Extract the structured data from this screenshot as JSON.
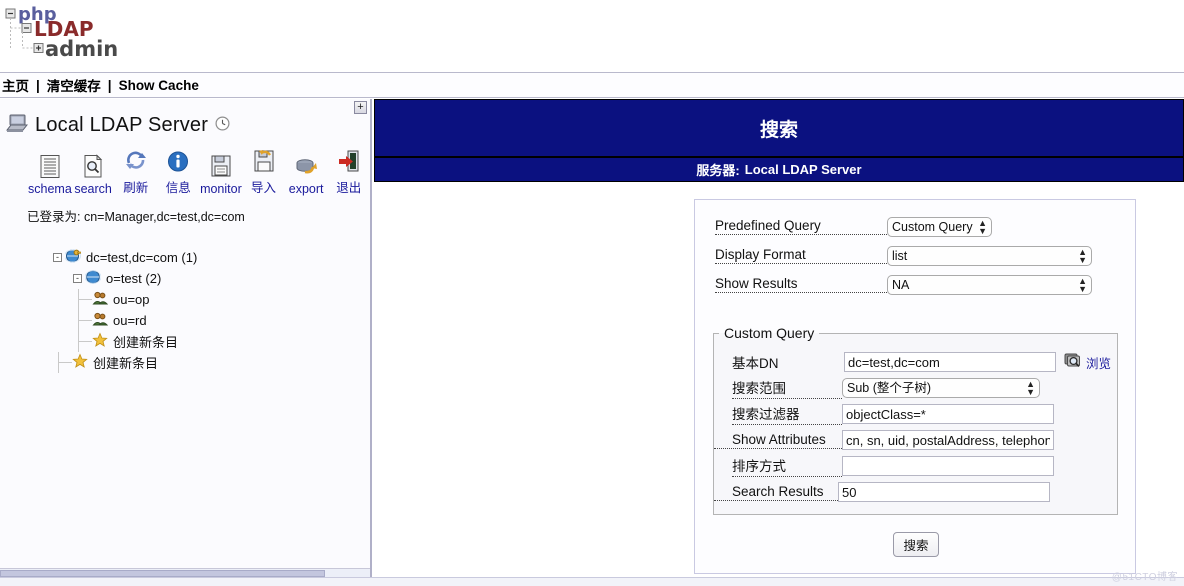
{
  "logo": {
    "line1": "php",
    "line2": "LDAP",
    "line3": "admin",
    "alt": "phpLDAPadmin"
  },
  "navbar": {
    "items": [
      {
        "label": "主页",
        "name": "nav-home"
      },
      {
        "label": "清空缓存",
        "name": "nav-purge-cache"
      },
      {
        "label": "Show Cache",
        "name": "nav-show-cache"
      }
    ],
    "separator": "|"
  },
  "sidebar": {
    "expander_glyph": "+",
    "server_name": "Local LDAP Server",
    "server_icon": "computer-icon",
    "clock_icon": "clock-icon",
    "toolbar": [
      {
        "label": "schema",
        "icon": "schema-icon"
      },
      {
        "label": "search",
        "icon": "search-icon"
      },
      {
        "label": "刷新",
        "icon": "refresh-icon"
      },
      {
        "label": "信息",
        "icon": "info-icon"
      },
      {
        "label": "monitor",
        "icon": "monitor-icon"
      },
      {
        "label": "导入",
        "icon": "import-icon"
      },
      {
        "label": "export",
        "icon": "export-icon"
      },
      {
        "label": "退出",
        "icon": "logout-icon"
      }
    ],
    "logged_in": "已登录为: cn=Manager,dc=test,dc=com",
    "tree": [
      {
        "label": "dc=test,dc=com (1)",
        "icon": "globe-key-icon",
        "ctrl": "-",
        "depth": 0
      },
      {
        "label": "o=test (2)",
        "icon": "globe-icon",
        "ctrl": "-",
        "depth": 1
      },
      {
        "label": "ou=op",
        "icon": "users-icon",
        "ctrl": "",
        "depth": 2
      },
      {
        "label": "ou=rd",
        "icon": "users-icon",
        "ctrl": "",
        "depth": 2
      },
      {
        "label": "创建新条目",
        "icon": "star-icon",
        "ctrl": "",
        "depth": 2
      },
      {
        "label": "创建新条目",
        "icon": "star-icon",
        "ctrl": "",
        "depth": 1
      }
    ]
  },
  "main": {
    "banner_title": "搜索",
    "server_label": "服务器:",
    "server_value": "Local LDAP Server",
    "top_fields": [
      {
        "label": "Predefined Query",
        "value": "Custom Query",
        "name": "predefined-query",
        "width": "narrow"
      },
      {
        "label": "Display Format",
        "value": "list",
        "name": "display-format",
        "width": "wide"
      },
      {
        "label": "Show Results",
        "value": "NA",
        "name": "show-results",
        "width": "wide"
      }
    ],
    "custom_query": {
      "legend": "Custom Query",
      "base_dn_label": "基本DN",
      "base_dn_value": "dc=test,dc=com",
      "browse_label": "浏览",
      "browse_icon": "browse-magnifier-icon",
      "scope_label": "搜索范围",
      "scope_value": "Sub (整个子树)",
      "filter_label": "搜索过滤器",
      "filter_value": "objectClass=*",
      "attributes_label": "Show Attributes",
      "attributes_value": "cn, sn, uid, postalAddress, telephon",
      "sort_label": "排序方式",
      "sort_value": "",
      "results_label": "Search Results",
      "results_value": "50"
    },
    "submit_label": "搜索"
  },
  "watermark": "@51CTO博客"
}
